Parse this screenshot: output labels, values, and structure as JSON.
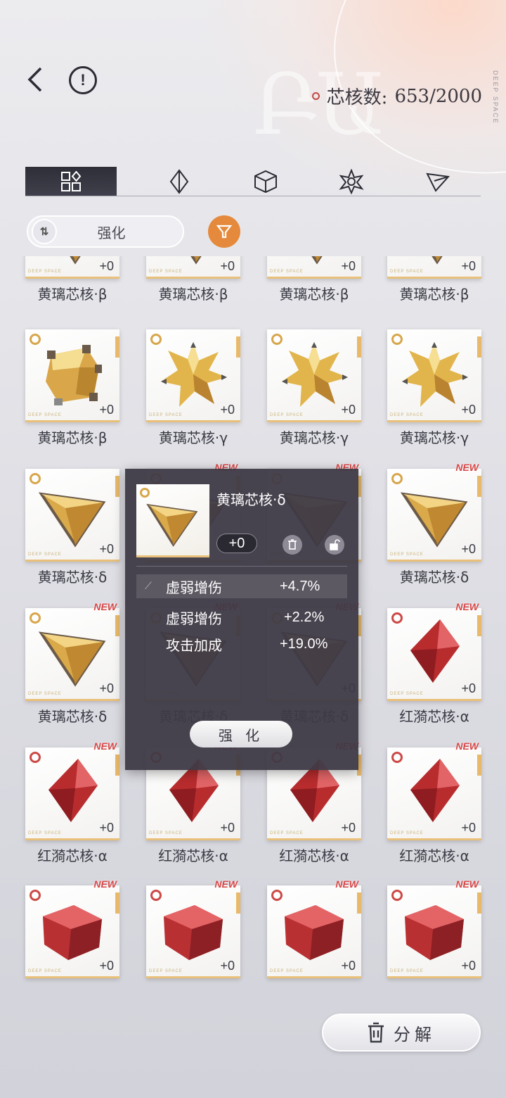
{
  "header": {
    "core_count_label": "芯核数:",
    "core_count": "653/2000",
    "watermark": "DEEP SPACE"
  },
  "tabs": [
    {
      "id": "all",
      "icon": "grid-icon"
    },
    {
      "id": "type1",
      "icon": "crystal-icon"
    },
    {
      "id": "type2",
      "icon": "cube-icon"
    },
    {
      "id": "type3",
      "icon": "star-icon"
    },
    {
      "id": "type4",
      "icon": "pyramid-icon"
    }
  ],
  "sort": {
    "label": "强化"
  },
  "grid": {
    "top_row": [
      {
        "name": "黄璃芯核·β",
        "level": "+0"
      },
      {
        "name": "黄璃芯核·β",
        "level": "+0"
      },
      {
        "name": "黄璃芯核·β",
        "level": "+0"
      },
      {
        "name": "黄璃芯核·β",
        "level": "+0"
      }
    ],
    "row1": [
      {
        "name": "黄璃芯核·β",
        "level": "+0",
        "kind": "cube",
        "color": "gold"
      },
      {
        "name": "黄璃芯核·γ",
        "level": "+0",
        "kind": "star",
        "color": "gold"
      },
      {
        "name": "黄璃芯核·γ",
        "level": "+0",
        "kind": "star",
        "color": "gold"
      },
      {
        "name": "黄璃芯核·γ",
        "level": "+0",
        "kind": "star",
        "color": "gold"
      }
    ],
    "row2": [
      {
        "name": "黄璃芯核·δ",
        "level": "+0",
        "new": ""
      },
      {
        "name": "",
        "level": "",
        "new": "NEW"
      },
      {
        "name": "",
        "level": "",
        "new": "NEW"
      },
      {
        "name": "黄璃芯核·δ",
        "level": "+0",
        "new": "NEW"
      }
    ],
    "row3": [
      {
        "name": "黄璃芯核·δ",
        "level": "+0",
        "new": "NEW"
      },
      {
        "name": "黄璃芯核·δ",
        "level": "",
        "new": "NEW"
      },
      {
        "name": "黄璃芯核·δ",
        "level": "+0",
        "new": "NEW"
      },
      {
        "name": "红漪芯核·α",
        "level": "+0",
        "new": "NEW"
      }
    ],
    "row4": [
      {
        "name": "红漪芯核·α",
        "level": "+0",
        "new": "NEW"
      },
      {
        "name": "红漪芯核·α",
        "level": "+0",
        "new": "NEW"
      },
      {
        "name": "红漪芯核·α",
        "level": "+0",
        "new": "NEW"
      },
      {
        "name": "红漪芯核·α",
        "level": "+0",
        "new": "NEW"
      }
    ],
    "row5": [
      {
        "name": "",
        "level": "+0",
        "new": "NEW"
      },
      {
        "name": "",
        "level": "+0",
        "new": "NEW"
      },
      {
        "name": "",
        "level": "+0",
        "new": "NEW"
      },
      {
        "name": "",
        "level": "+0",
        "new": "NEW"
      }
    ]
  },
  "popup": {
    "title": "黄璃芯核·δ",
    "level": "+0",
    "stats": [
      {
        "label": "虚弱增伤",
        "value": "+4.7%"
      },
      {
        "label": "虚弱增伤",
        "value": "+2.2%"
      },
      {
        "label": "攻击加成",
        "value": "+19.0%"
      }
    ],
    "enhance_label": "强 化"
  },
  "footer": {
    "decompose_label": "分解"
  },
  "colors": {
    "accent": "#e58a3c",
    "gold": "#e9c07a",
    "red": "#cc4a46",
    "popup_bg": "#3e3a46"
  }
}
